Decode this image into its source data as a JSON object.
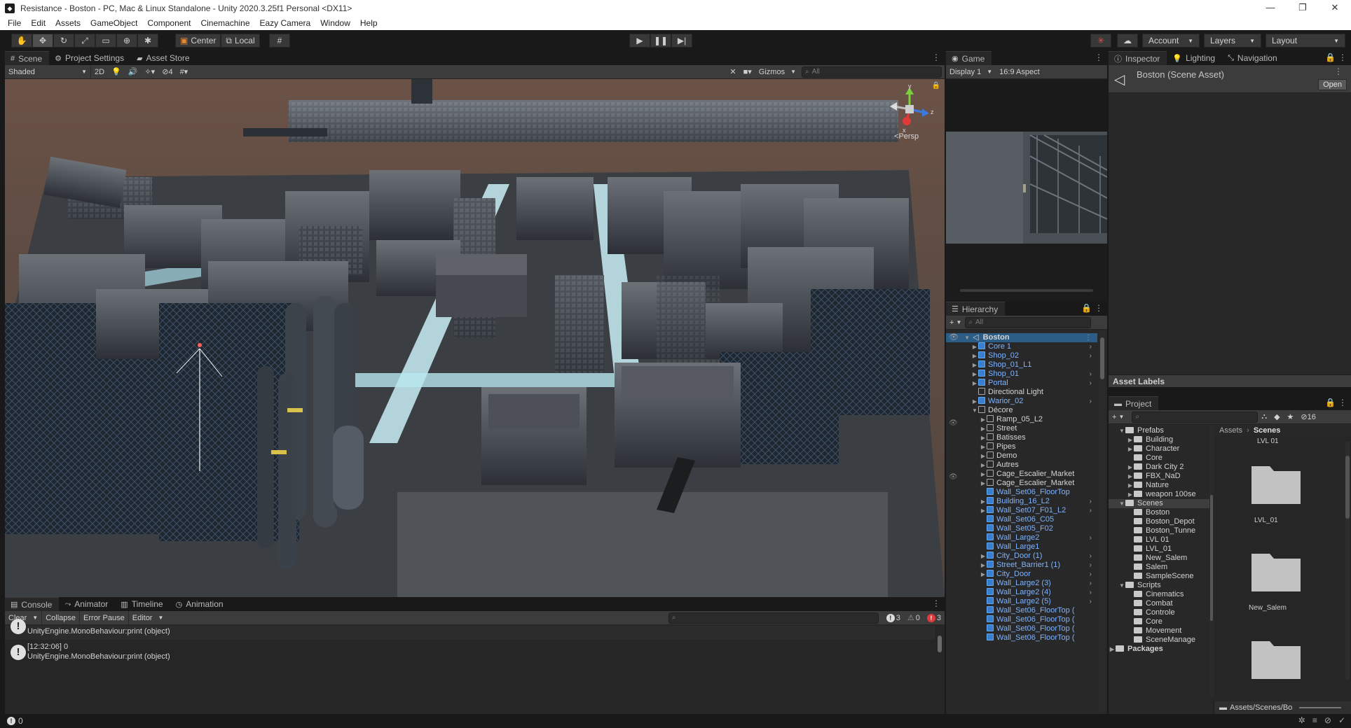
{
  "window": {
    "title": "Resistance - Boston - PC, Mac & Linux Standalone - Unity 2020.3.25f1 Personal <DX11>",
    "controls": [
      "—",
      "❐",
      "✕"
    ]
  },
  "menu": [
    "File",
    "Edit",
    "Assets",
    "GameObject",
    "Component",
    "Cinemachine",
    "Eazy Camera",
    "Window",
    "Help"
  ],
  "toolbar": {
    "pivot_label": "Center",
    "space_label": "Local",
    "account_label": "Account",
    "layers_label": "Layers",
    "layout_label": "Layout"
  },
  "scene_panel": {
    "tabs": [
      "Scene",
      "Project Settings",
      "Asset Store"
    ],
    "shading_mode": "Shaded",
    "mode_2d": "2D",
    "hidden_count": "4",
    "gizmos_label": "Gizmos",
    "search_placeholder": "All",
    "persp_label": "Persp",
    "axis_labels": {
      "x": "x",
      "y": "y",
      "z": "z"
    }
  },
  "game_panel": {
    "tab": "Game",
    "display": "Display 1",
    "aspect": "16:9 Aspect"
  },
  "inspector_panel": {
    "tabs": [
      "Inspector",
      "Lighting",
      "Navigation"
    ],
    "asset_title": "Boston (Scene Asset)",
    "open_button": "Open",
    "asset_labels": "Asset Labels"
  },
  "hierarchy": {
    "tab": "Hierarchy",
    "search_placeholder": "All",
    "root": "Boston",
    "items": [
      {
        "label": "Core 1",
        "type": "prefab",
        "depth": 1,
        "expand": true,
        "chevron": true
      },
      {
        "label": "Shop_02",
        "type": "prefab",
        "depth": 1,
        "expand": true,
        "chevron": true
      },
      {
        "label": "Shop_01_L1",
        "type": "prefab",
        "depth": 1,
        "expand": true,
        "chevron": false
      },
      {
        "label": "Shop_01",
        "type": "prefab",
        "depth": 1,
        "expand": true,
        "chevron": true
      },
      {
        "label": "Portal",
        "type": "prefab",
        "depth": 1,
        "expand": true,
        "chevron": true
      },
      {
        "label": "Directional Light",
        "type": "object",
        "depth": 1,
        "expand": false,
        "chevron": false
      },
      {
        "label": "Warior_02",
        "type": "prefab",
        "depth": 1,
        "expand": true,
        "chevron": true
      },
      {
        "label": "Décore",
        "type": "object",
        "depth": 1,
        "expand": "open",
        "chevron": false
      },
      {
        "label": "Ramp_05_L2",
        "type": "object",
        "depth": 2,
        "expand": true,
        "chevron": false
      },
      {
        "label": "Street",
        "type": "object",
        "depth": 2,
        "expand": true,
        "chevron": false
      },
      {
        "label": "Batisses",
        "type": "object",
        "depth": 2,
        "expand": true,
        "chevron": false
      },
      {
        "label": "Pipes",
        "type": "object",
        "depth": 2,
        "expand": true,
        "chevron": false
      },
      {
        "label": "Demo",
        "type": "object",
        "depth": 2,
        "expand": true,
        "chevron": false
      },
      {
        "label": "Autres",
        "type": "object",
        "depth": 2,
        "expand": true,
        "chevron": false
      },
      {
        "label": "Cage_Escalier_Market",
        "type": "object",
        "depth": 2,
        "expand": true,
        "chevron": false
      },
      {
        "label": "Cage_Escalier_Market",
        "type": "object",
        "depth": 2,
        "expand": true,
        "chevron": false
      },
      {
        "label": "Wall_Set06_FloorTop",
        "type": "prefab",
        "depth": 2,
        "expand": false,
        "chevron": false
      },
      {
        "label": "Building_16_L2",
        "type": "prefab",
        "depth": 2,
        "expand": true,
        "chevron": true
      },
      {
        "label": "Wall_Set07_F01_L2",
        "type": "prefab",
        "depth": 2,
        "expand": true,
        "chevron": true
      },
      {
        "label": "Wall_Set06_C05",
        "type": "prefab",
        "depth": 2,
        "expand": false,
        "chevron": false
      },
      {
        "label": "Wall_Set05_F02",
        "type": "prefab",
        "depth": 2,
        "expand": false,
        "chevron": false
      },
      {
        "label": "Wall_Large2",
        "type": "prefab",
        "depth": 2,
        "expand": false,
        "chevron": true
      },
      {
        "label": "Wall_Large1",
        "type": "prefab",
        "depth": 2,
        "expand": false,
        "chevron": false
      },
      {
        "label": "City_Door (1)",
        "type": "prefab",
        "depth": 2,
        "expand": true,
        "chevron": true
      },
      {
        "label": "Street_Barrier1 (1)",
        "type": "prefab",
        "depth": 2,
        "expand": true,
        "chevron": true
      },
      {
        "label": "City_Door",
        "type": "prefab",
        "depth": 2,
        "expand": true,
        "chevron": true
      },
      {
        "label": "Wall_Large2 (3)",
        "type": "prefab",
        "depth": 2,
        "expand": false,
        "chevron": true
      },
      {
        "label": "Wall_Large2 (4)",
        "type": "prefab",
        "depth": 2,
        "expand": false,
        "chevron": true
      },
      {
        "label": "Wall_Large2 (5)",
        "type": "prefab",
        "depth": 2,
        "expand": false,
        "chevron": true
      },
      {
        "label": "Wall_Set06_FloorTop (",
        "type": "prefab",
        "depth": 2,
        "expand": false,
        "chevron": false
      },
      {
        "label": "Wall_Set06_FloorTop (",
        "type": "prefab",
        "depth": 2,
        "expand": false,
        "chevron": false
      },
      {
        "label": "Wall_Set06_FloorTop (",
        "type": "prefab",
        "depth": 2,
        "expand": false,
        "chevron": false
      },
      {
        "label": "Wall_Set06_FloorTop (",
        "type": "prefab",
        "depth": 2,
        "expand": false,
        "chevron": false
      }
    ]
  },
  "console": {
    "tabs": [
      "Console",
      "Animator",
      "Timeline",
      "Animation"
    ],
    "clear": "Clear",
    "collapse": "Collapse",
    "error_pause": "Error Pause",
    "editor": "Editor",
    "counts": {
      "log": "3",
      "warn": "0",
      "error": "3"
    },
    "entries": [
      {
        "line1": "",
        "line2": "UnityEngine.MonoBehaviour:print (object)"
      },
      {
        "line1": "[12:32:06] 0",
        "line2": "UnityEngine.MonoBehaviour:print (object)"
      }
    ]
  },
  "project": {
    "tab": "Project",
    "hidden_count": "16",
    "breadcrumb": [
      "Assets",
      "Scenes"
    ],
    "tree": [
      {
        "label": "Prefabs",
        "depth": 1,
        "arrow": "open"
      },
      {
        "label": "Building",
        "depth": 2,
        "arrow": "closed"
      },
      {
        "label": "Character",
        "depth": 2,
        "arrow": "closed"
      },
      {
        "label": "Core",
        "depth": 2,
        "arrow": ""
      },
      {
        "label": "Dark City 2",
        "depth": 2,
        "arrow": "closed"
      },
      {
        "label": "FBX_NaD",
        "depth": 2,
        "arrow": "closed"
      },
      {
        "label": "Nature",
        "depth": 2,
        "arrow": "closed"
      },
      {
        "label": "weapon 100se",
        "depth": 2,
        "arrow": "closed"
      },
      {
        "label": "Scenes",
        "depth": 1,
        "arrow": "open"
      },
      {
        "label": "Boston",
        "depth": 2,
        "arrow": ""
      },
      {
        "label": "Boston_Depot",
        "depth": 2,
        "arrow": ""
      },
      {
        "label": "Boston_Tunne",
        "depth": 2,
        "arrow": ""
      },
      {
        "label": "LVL 01",
        "depth": 2,
        "arrow": ""
      },
      {
        "label": "LVL_01",
        "depth": 2,
        "arrow": ""
      },
      {
        "label": "New_Salem",
        "depth": 2,
        "arrow": ""
      },
      {
        "label": "Salem",
        "depth": 2,
        "arrow": ""
      },
      {
        "label": "SampleScene",
        "depth": 2,
        "arrow": ""
      },
      {
        "label": "Scripts",
        "depth": 1,
        "arrow": "open"
      },
      {
        "label": "Cinematics",
        "depth": 2,
        "arrow": ""
      },
      {
        "label": "Combat",
        "depth": 2,
        "arrow": ""
      },
      {
        "label": "Controle",
        "depth": 2,
        "arrow": ""
      },
      {
        "label": "Core",
        "depth": 2,
        "arrow": ""
      },
      {
        "label": "Movement",
        "depth": 2,
        "arrow": ""
      },
      {
        "label": "SceneManage",
        "depth": 2,
        "arrow": ""
      }
    ],
    "packages": "Packages",
    "grid_items": [
      "LVL 01",
      "LVL_01",
      "New_Salem"
    ],
    "footer_path": "Assets/Scenes/Bo"
  },
  "statusbar": {
    "count": "0"
  },
  "colors": {
    "selection": "#2c5d87",
    "prefab_text": "#7fb3ff",
    "error_red": "#e03a3a"
  }
}
